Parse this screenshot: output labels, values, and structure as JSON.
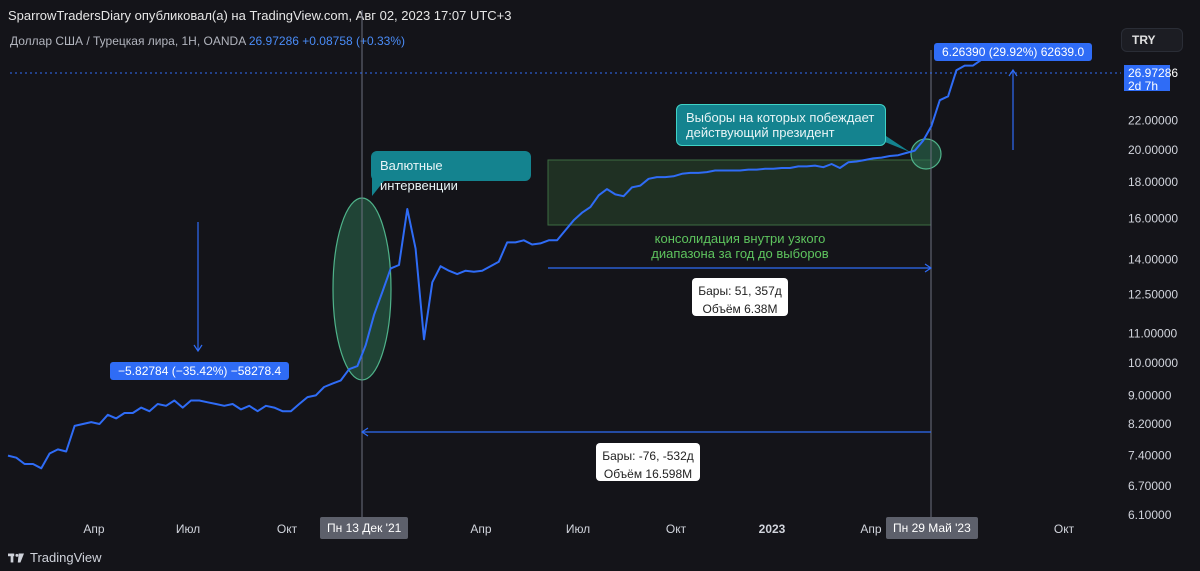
{
  "header": {
    "attribution": "SparrowTradersDiary опубликовал(а) на TradingView.com, Авг 02, 2023 17:07 UTC+3"
  },
  "legend": {
    "symbol": "Доллар США / Турецкая лира, 1H, OANDA",
    "price": "26.97286",
    "change": "+0.08758 (+0.33%)"
  },
  "currency_button": "TRY",
  "footer": {
    "brand": "TradingView"
  },
  "price_tag": {
    "price": "26.97286",
    "countdown": "2d 7h"
  },
  "annotations": {
    "interventions": "Валютные интервенции",
    "elections_line1": "Выборы на которых побеждает",
    "elections_line2": "действующий президент",
    "consolidation_line1": "консолидация внутри узкого",
    "consolidation_line2": "диапазона за год до выборов",
    "range_box_top_line1": "Бары: 51, 357д",
    "range_box_top_line2": "Объём 6.38M",
    "range_box_bottom_line1": "Бары: -76, -532д",
    "range_box_bottom_line2": "Объём 16.598M",
    "pill_left": "−5.82784 (−35.42%) −58278.4",
    "pill_right": "6.26390 (29.92%) 62639.0",
    "date_left": "Пн 13 Дек '21",
    "date_right": "Пн 29 Май '23"
  },
  "colors": {
    "line": "#2f6cf6",
    "accent": "#2f6cf6",
    "callout": "#14838f",
    "consolidation": "#5ec45e"
  },
  "chart_data": {
    "type": "line",
    "title": "",
    "xlabel": "",
    "ylabel": "",
    "yscale": "log",
    "ylim": [
      6.1,
      30.5
    ],
    "grid": false,
    "x_ticks": [
      "Апр",
      "Июл",
      "Окт",
      "Апр",
      "Июл",
      "Окт",
      "2023",
      "Апр",
      "Окт"
    ],
    "y_ticks": [
      "6.10000",
      "6.70000",
      "7.40000",
      "8.20000",
      "9.00000",
      "10.00000",
      "11.00000",
      "12.50000",
      "14.00000",
      "16.00000",
      "18.00000",
      "20.00000",
      "22.00000"
    ],
    "series": [
      {
        "values": [
          7.4,
          7.35,
          7.2,
          7.2,
          7.1,
          7.45,
          7.55,
          7.5,
          8.15,
          8.2,
          8.25,
          8.2,
          8.45,
          8.35,
          8.5,
          8.5,
          8.65,
          8.55,
          8.75,
          8.7,
          8.85,
          8.65,
          8.85,
          8.85,
          8.8,
          8.75,
          8.7,
          8.75,
          8.6,
          8.7,
          8.55,
          8.7,
          8.65,
          8.55,
          8.55,
          8.75,
          8.95,
          9.0,
          9.25,
          9.35,
          9.45,
          9.8,
          9.9,
          10.6,
          11.7,
          12.6,
          13.6,
          13.75,
          16.5,
          14.5,
          10.8,
          13.0,
          13.7,
          13.5,
          13.35,
          13.5,
          13.45,
          13.5,
          13.7,
          13.9,
          14.8,
          14.8,
          14.9,
          14.7,
          14.75,
          14.9,
          14.9,
          15.4,
          15.9,
          16.3,
          16.6,
          17.25,
          17.6,
          17.3,
          17.2,
          17.7,
          17.8,
          18.2,
          18.3,
          18.3,
          18.35,
          18.5,
          18.55,
          18.55,
          18.6,
          18.7,
          18.7,
          18.7,
          18.7,
          18.75,
          18.75,
          18.8,
          18.8,
          18.85,
          18.85,
          18.95,
          18.95,
          19.0,
          18.9,
          19.1,
          18.85,
          19.2,
          19.25,
          19.35,
          19.45,
          19.5,
          19.6,
          19.65,
          19.8,
          19.95,
          20.6,
          21.6,
          23.5,
          23.8,
          25.9,
          26.3,
          26.3,
          26.8,
          26.9,
          26.97
        ]
      }
    ],
    "last_price": 26.97286
  }
}
